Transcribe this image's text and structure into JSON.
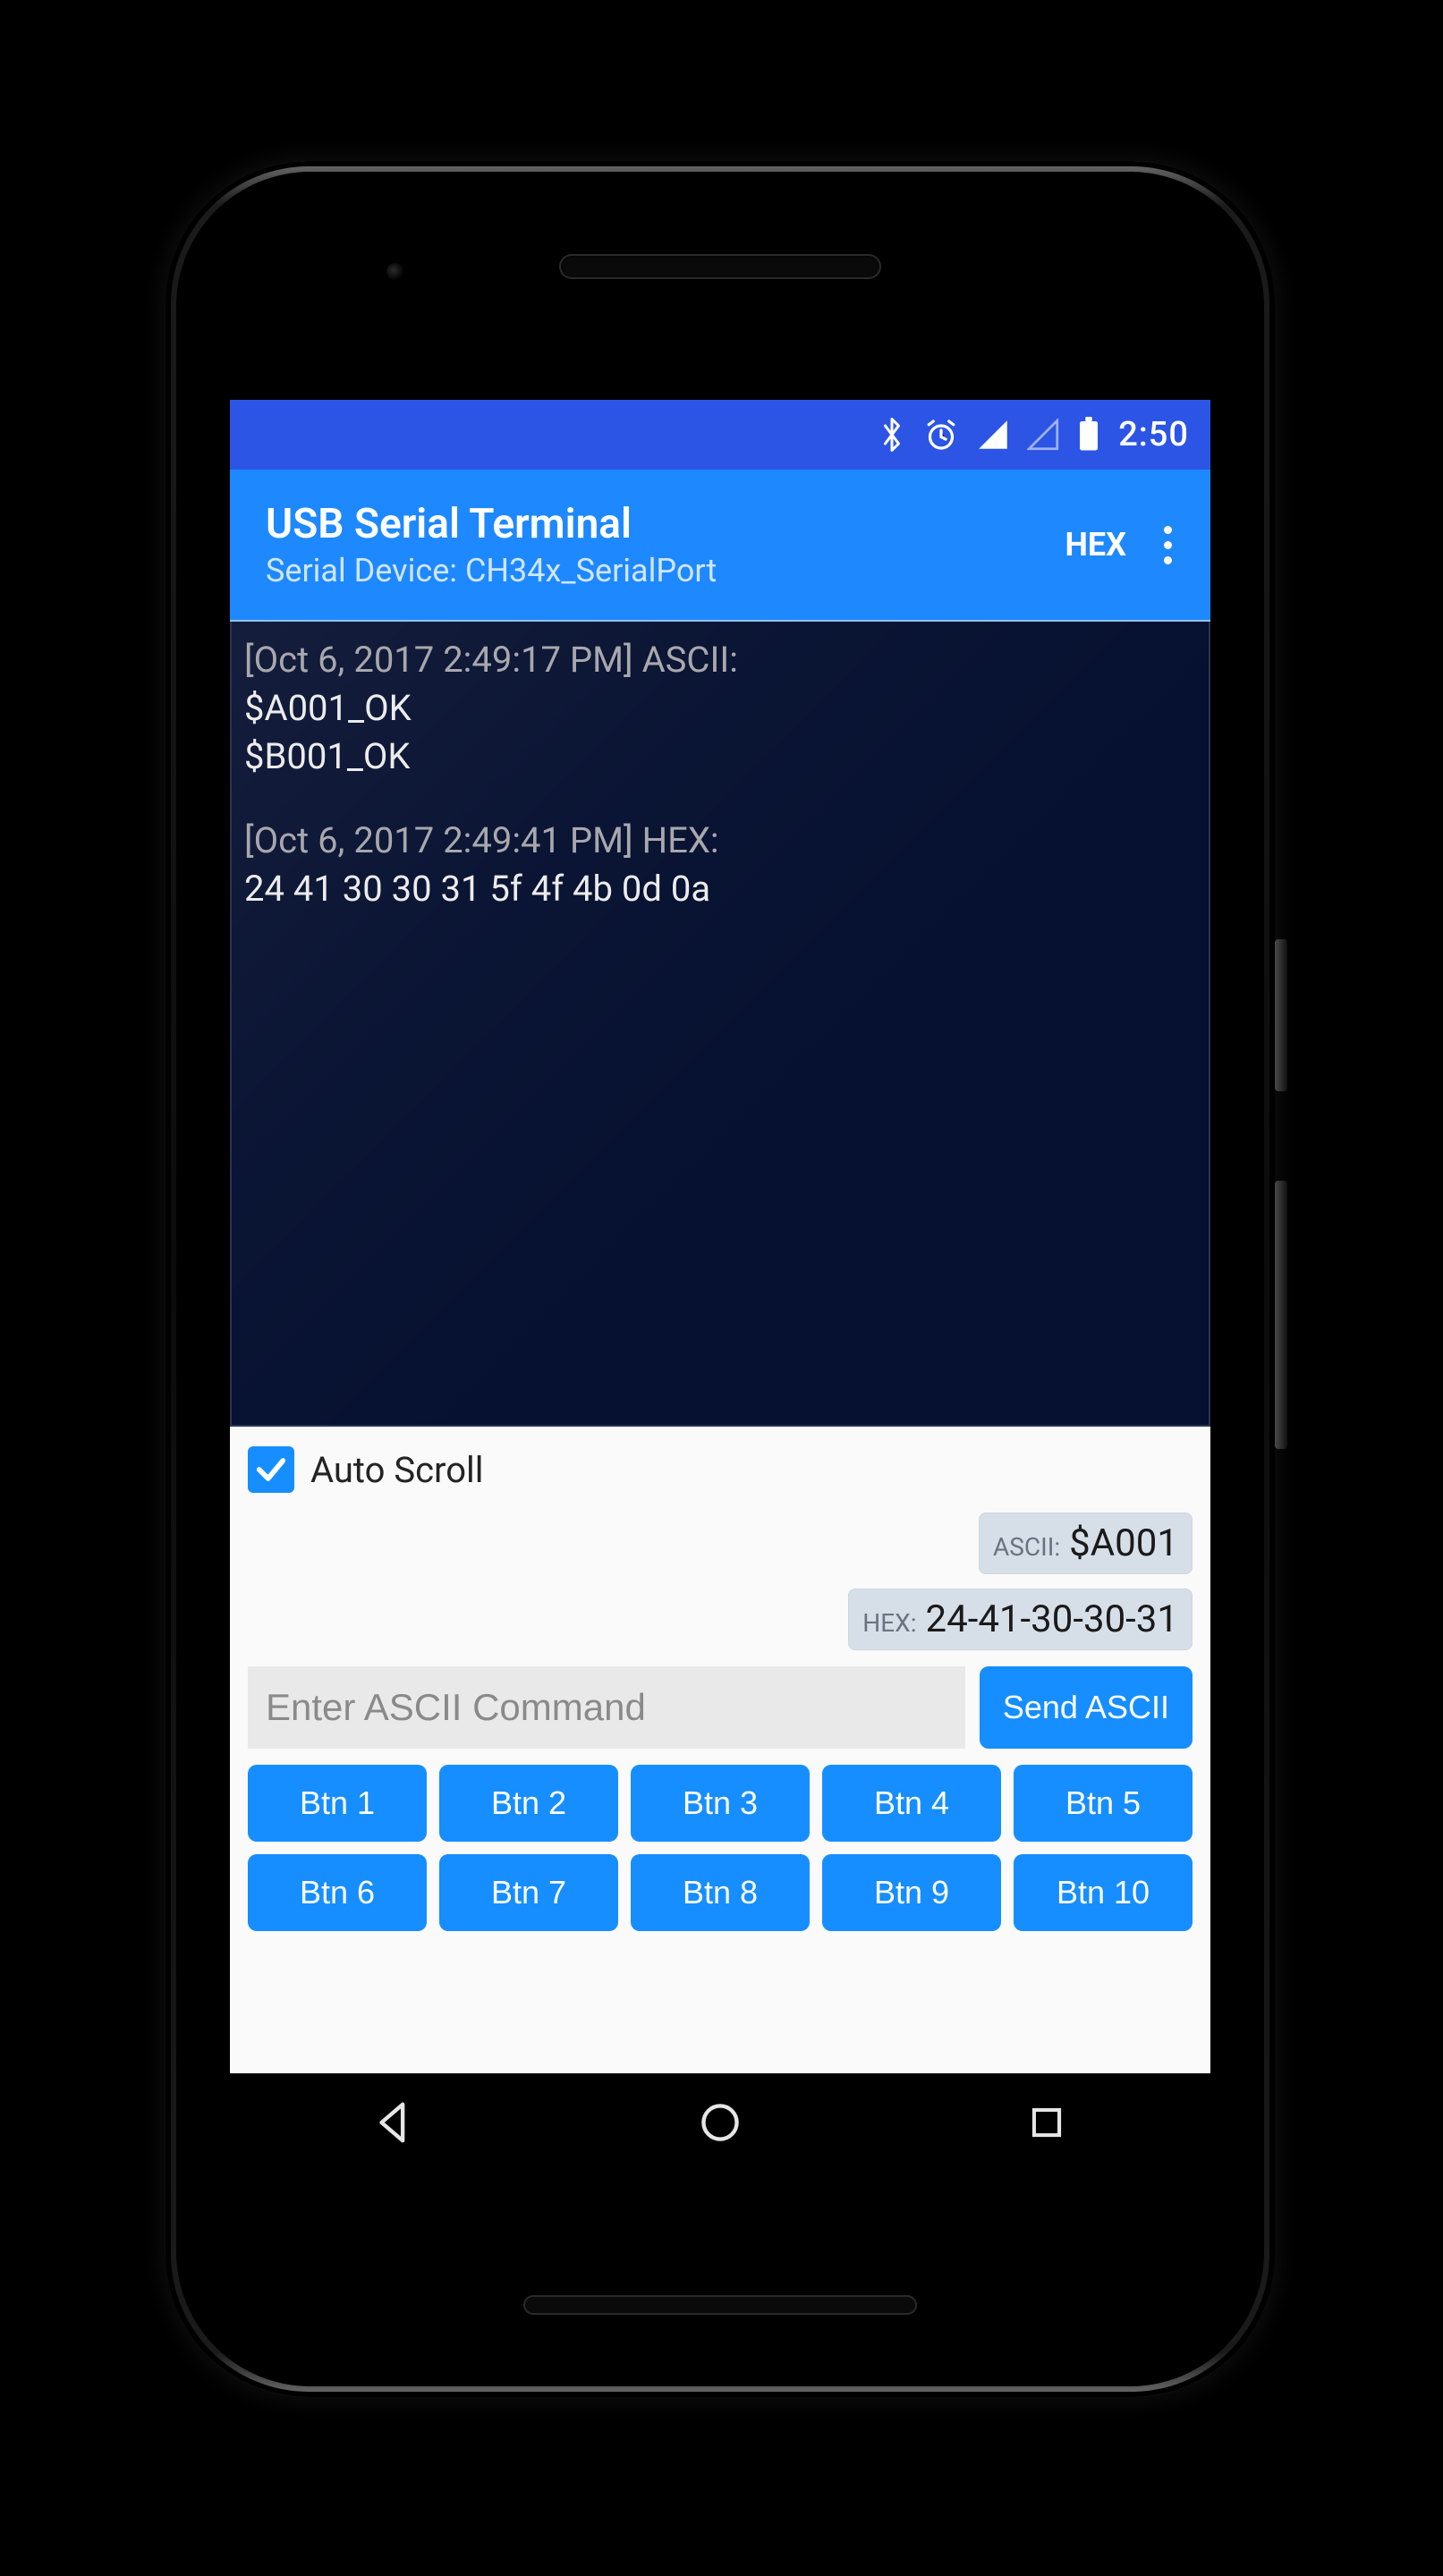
{
  "status": {
    "time": "2:50"
  },
  "app": {
    "title": "USB Serial Terminal",
    "subtitle": "Serial Device: CH34x_SerialPort",
    "action_mode": "HEX"
  },
  "terminal": {
    "lines": [
      {
        "ts": "[Oct 6, 2017 2:49:17 PM] ASCII:",
        "body": [
          "$A001_OK",
          "$B001_OK"
        ]
      },
      {
        "ts": "[Oct 6, 2017 2:49:41 PM] HEX:",
        "body": [
          "24 41 30 30 31 5f 4f 4b 0d 0a"
        ]
      }
    ]
  },
  "auto_scroll": {
    "label": "Auto Scroll",
    "checked": true
  },
  "chips": {
    "ascii_key": "ASCII:",
    "ascii_val": "$A001",
    "hex_key": "HEX:",
    "hex_val": "24-41-30-30-31"
  },
  "input": {
    "placeholder": "Enter ASCII Command",
    "send_label": "Send ASCII"
  },
  "buttons": [
    "Btn 1",
    "Btn 2",
    "Btn 3",
    "Btn 4",
    "Btn 5",
    "Btn 6",
    "Btn 7",
    "Btn 8",
    "Btn 9",
    "Btn 10"
  ]
}
